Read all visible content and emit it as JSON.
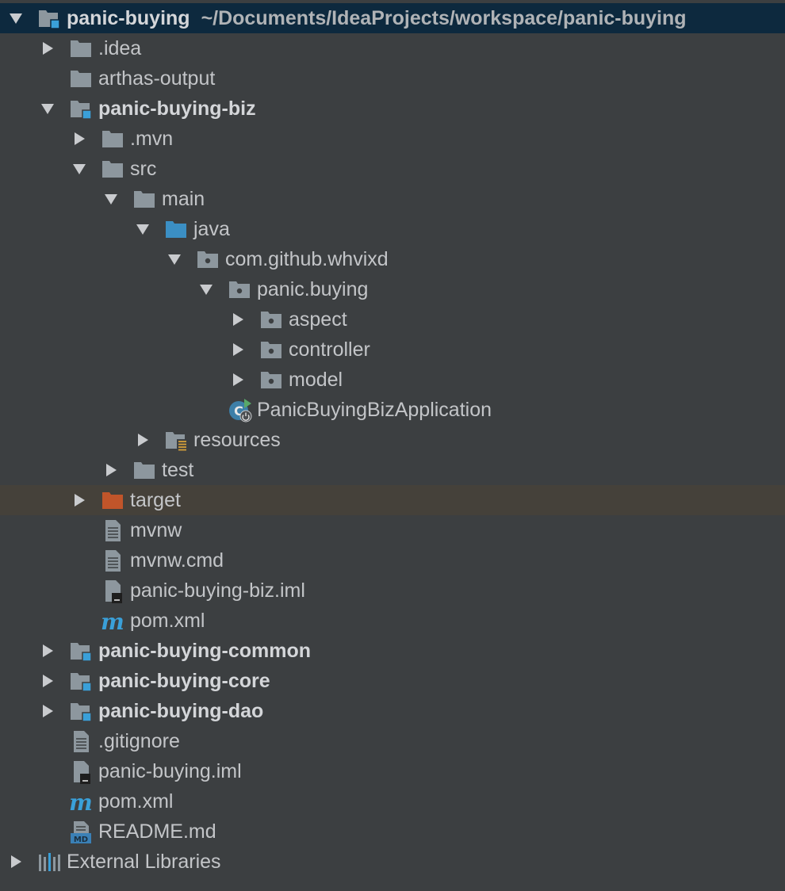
{
  "project": {
    "root_name": "panic-buying",
    "root_path": "~/Documents/IdeaProjects/workspace/panic-buying"
  },
  "colors": {
    "selected_row": "#0d293e",
    "highlight_row": "#45413a",
    "folder": "#8d979e",
    "module_badge": "#3aa0d9",
    "source_folder": "#3b8fc4",
    "excluded_folder": "#c1552a",
    "maven": "#3aa0d9"
  },
  "tree": [
    {
      "label": "panic-buying",
      "icon": "module-folder-icon",
      "state": "expanded"
    },
    {
      "label": ".idea",
      "icon": "folder-icon",
      "state": "collapsed"
    },
    {
      "label": "arthas-output",
      "icon": "folder-icon",
      "state": "leaf"
    },
    {
      "label": "panic-buying-biz",
      "icon": "module-folder-icon",
      "state": "expanded"
    },
    {
      "label": ".mvn",
      "icon": "folder-icon",
      "state": "collapsed"
    },
    {
      "label": "src",
      "icon": "folder-icon",
      "state": "expanded"
    },
    {
      "label": "main",
      "icon": "folder-icon",
      "state": "expanded"
    },
    {
      "label": "java",
      "icon": "source-folder-icon",
      "state": "expanded"
    },
    {
      "label": "com.github.whvixd",
      "icon": "package-icon",
      "state": "expanded"
    },
    {
      "label": "panic.buying",
      "icon": "package-icon",
      "state": "expanded"
    },
    {
      "label": "aspect",
      "icon": "package-icon",
      "state": "collapsed"
    },
    {
      "label": "controller",
      "icon": "package-icon",
      "state": "collapsed"
    },
    {
      "label": "model",
      "icon": "package-icon",
      "state": "collapsed"
    },
    {
      "label": "PanicBuyingBizApplication",
      "icon": "spring-boot-class-icon",
      "state": "leaf"
    },
    {
      "label": "resources",
      "icon": "resources-folder-icon",
      "state": "collapsed"
    },
    {
      "label": "test",
      "icon": "folder-icon",
      "state": "collapsed"
    },
    {
      "label": "target",
      "icon": "excluded-folder-icon",
      "state": "collapsed"
    },
    {
      "label": "mvnw",
      "icon": "text-file-icon",
      "state": "leaf"
    },
    {
      "label": "mvnw.cmd",
      "icon": "text-file-icon",
      "state": "leaf"
    },
    {
      "label": "panic-buying-biz.iml",
      "icon": "iml-file-icon",
      "state": "leaf"
    },
    {
      "label": "pom.xml",
      "icon": "maven-icon",
      "state": "leaf"
    },
    {
      "label": "panic-buying-common",
      "icon": "module-folder-icon",
      "state": "collapsed"
    },
    {
      "label": "panic-buying-core",
      "icon": "module-folder-icon",
      "state": "collapsed"
    },
    {
      "label": "panic-buying-dao",
      "icon": "module-folder-icon",
      "state": "collapsed"
    },
    {
      "label": ".gitignore",
      "icon": "text-file-icon",
      "state": "leaf"
    },
    {
      "label": "panic-buying.iml",
      "icon": "iml-file-icon",
      "state": "leaf"
    },
    {
      "label": "pom.xml",
      "icon": "maven-icon",
      "state": "leaf"
    },
    {
      "label": "README.md",
      "icon": "markdown-file-icon",
      "state": "leaf"
    },
    {
      "label": "External Libraries",
      "icon": "libraries-icon",
      "state": "collapsed"
    }
  ]
}
